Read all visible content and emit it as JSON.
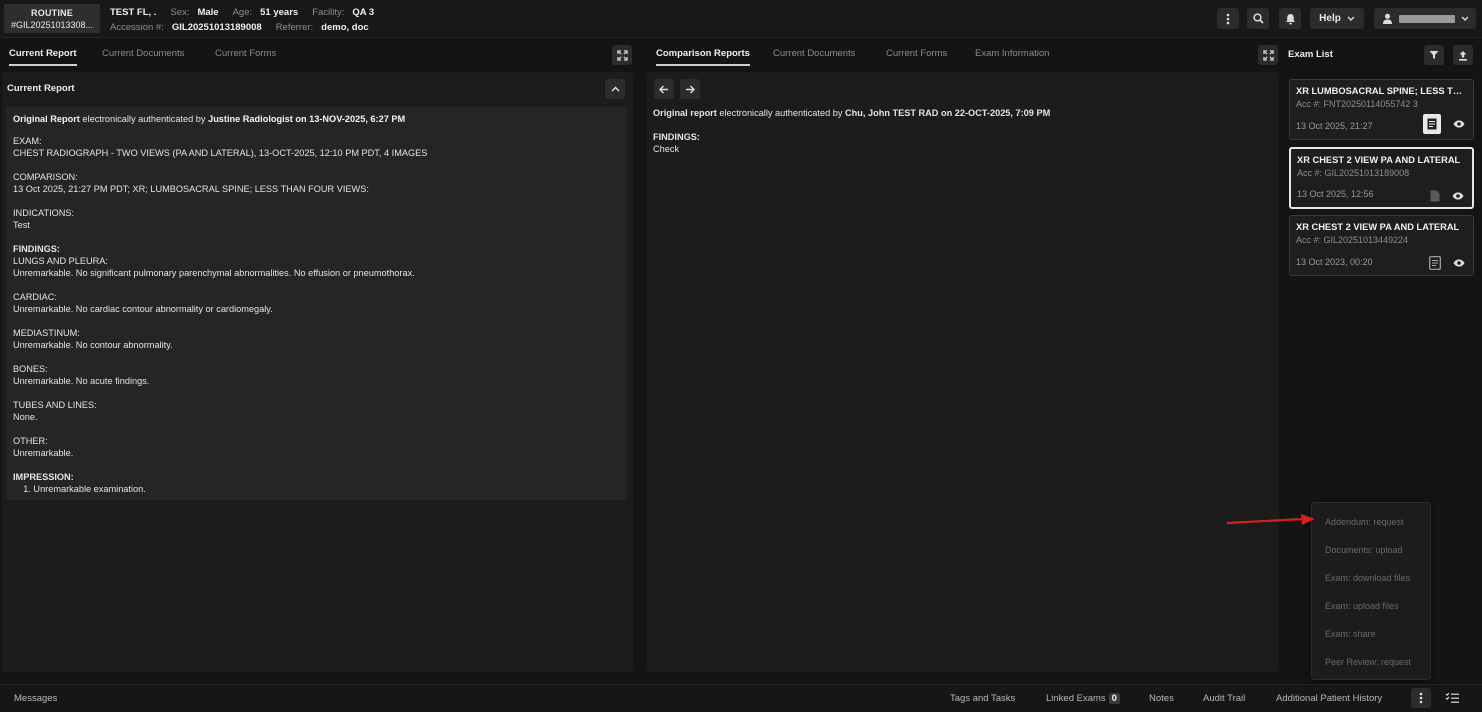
{
  "header": {
    "priority": "ROUTINE",
    "order_id": "#GIL20251013308...",
    "patient_name": "TEST FL, .",
    "sex_label": "Sex:",
    "sex": "Male",
    "age_label": "Age:",
    "age": "51 years",
    "facility_label": "Facility:",
    "facility": "QA 3",
    "accession_label": "Accession #:",
    "accession": "GIL20251013189008",
    "referrer_label": "Referrer:",
    "referrer": "demo, doc",
    "help_label": "Help"
  },
  "left_panel": {
    "tabs": [
      "Current Report",
      "Current Documents",
      "Current Forms"
    ],
    "active_tab": 0,
    "section_title": "Current Report",
    "auth_prefix": "Original Report",
    "auth_middle": " electronically authenticated by ",
    "auth_by": "Justine Radiologist on 13-NOV-2025, 6:27 PM",
    "sections": [
      {
        "h": "EXAM:",
        "t": "CHEST RADIOGRAPH - TWO VIEWS (PA AND LATERAL), 13-OCT-2025, 12:10 PM PDT, 4 IMAGES",
        "bold": false
      },
      {
        "h": "COMPARISON:",
        "t": "13 Oct 2025, 21:27 PM PDT; XR; LUMBOSACRAL SPINE; LESS THAN FOUR VIEWS:",
        "bold": false
      },
      {
        "h": "INDICATIONS:",
        "t": "Test",
        "bold": false
      },
      {
        "h": "FINDINGS:",
        "t": "LUNGS AND PLEURA:\nUnremarkable. No significant pulmonary parenchymal abnormalities. No effusion or pneumothorax.",
        "bold": true
      },
      {
        "h": "CARDIAC:",
        "t": "Unremarkable. No cardiac contour abnormality or cardiomegaly.",
        "bold": false
      },
      {
        "h": "MEDIASTINUM:",
        "t": "Unremarkable. No contour abnormality.",
        "bold": false
      },
      {
        "h": "BONES:",
        "t": "Unremarkable. No acute findings.",
        "bold": false
      },
      {
        "h": "TUBES AND LINES:",
        "t": "None.",
        "bold": false
      },
      {
        "h": "OTHER:",
        "t": "Unremarkable.",
        "bold": false
      },
      {
        "h": "IMPRESSION:",
        "t": "    1. Unremarkable examination.",
        "bold": true
      }
    ]
  },
  "middle_panel": {
    "tabs": [
      "Comparison Reports",
      "Current Documents",
      "Current Forms",
      "Exam Information"
    ],
    "active_tab": 0,
    "auth_prefix": "Original report",
    "auth_middle": " electronically authenticated by ",
    "auth_by": "Chu, John TEST RAD on 22-OCT-2025, 7:09 PM",
    "findings_label": "FINDINGS:",
    "findings_text": "Check"
  },
  "exam_list": {
    "title": "Exam List",
    "items": [
      {
        "title": "XR LUMBOSACRAL SPINE; LESS TH...",
        "acc": "Acc #: FNT20250114055742 3",
        "date": "13 Oct 2025, 21:27"
      },
      {
        "title": "XR CHEST 2 VIEW PA AND LATERAL",
        "acc": "Acc #: GIL20251013189008",
        "date": "13 Oct 2025, 12:56"
      },
      {
        "title": "XR CHEST 2 VIEW PA AND LATERAL",
        "acc": "Acc #: GIL20251013449224",
        "date": "13 Oct 2023, 00:20"
      }
    ]
  },
  "context_menu": {
    "items": [
      "Addendum: request",
      "Documents: upload",
      "Exam: download files",
      "Exam: upload files",
      "Exam: share",
      "Peer Review: request"
    ]
  },
  "bottom_bar": {
    "messages": "Messages",
    "tags_tasks": "Tags and Tasks",
    "linked_exams": "Linked Exams",
    "linked_count": "0",
    "notes": "Notes",
    "audit_trail": "Audit Trail",
    "additional_history": "Additional Patient History"
  },
  "colors": {
    "background": "#141414",
    "panel": "#1c1c1c",
    "report_box": "#252525",
    "arrow": "#d42020"
  }
}
